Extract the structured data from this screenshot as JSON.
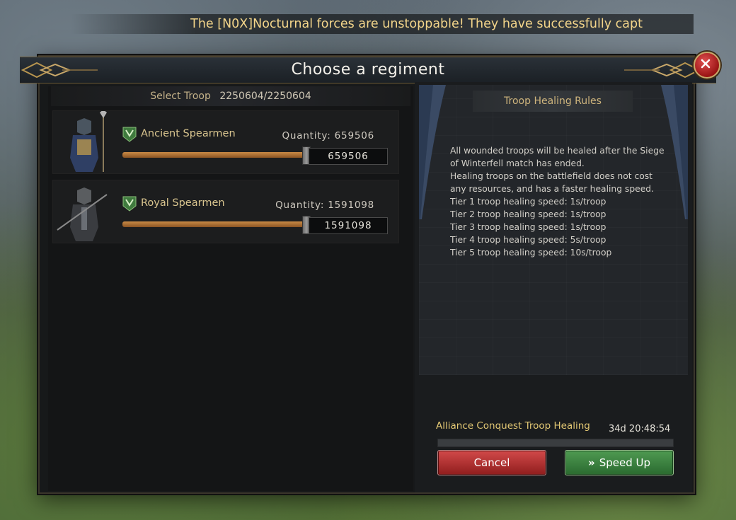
{
  "ticker": "The [N0X]Nocturnal forces are unstoppable! They have successfully capt",
  "dialog": {
    "title": "Choose a regiment",
    "close_icon": "close-icon"
  },
  "troops": {
    "select_label": "Select Troop",
    "select_count": "2250604/2250604",
    "items": [
      {
        "name": "Ancient Spearmen",
        "quantity_label": "Quantity: 659506",
        "value": "659506",
        "fill_fraction": 1.0
      },
      {
        "name": "Royal Spearmen",
        "quantity_label": "Quantity: 1591098",
        "value": "1591098",
        "fill_fraction": 1.0
      }
    ]
  },
  "rules": {
    "title": "Troop Healing Rules",
    "lines": [
      "All wounded troops will be healed after the Siege",
      "of Winterfell match has ended.",
      "Healing troops on the battlefield does not cost",
      "any resources, and has a faster healing speed.",
      "Tier 1 troop healing speed: 1s/troop",
      "Tier 2 troop healing speed: 1s/troop",
      "Tier 3 troop healing speed: 1s/troop",
      "Tier 4 troop healing speed: 5s/troop",
      "Tier 5 troop healing speed: 10s/troop"
    ]
  },
  "healing": {
    "label": "Alliance Conquest Troop Healing",
    "time": "34d 20:48:54",
    "progress_fraction": 0.0
  },
  "buttons": {
    "cancel": "Cancel",
    "speed_up": "Speed Up",
    "speed_up_icon": "double-chevron-icon"
  },
  "colors": {
    "accent_gold": "#d9c58f",
    "cancel_red": "#b83434",
    "speed_green": "#3f8a44"
  }
}
